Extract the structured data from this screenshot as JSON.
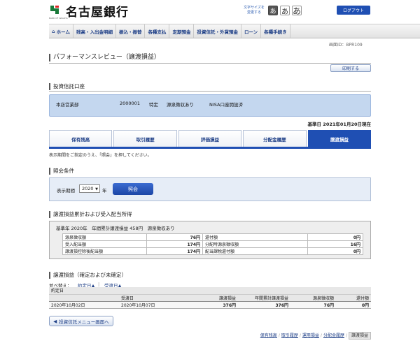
{
  "header": {
    "bank_name": "名古屋銀行",
    "bank_sub": "BANK OF NAGOYA",
    "font_size_label": "文字サイズを変更する",
    "font_sizes": [
      "あ",
      "あ",
      "あ"
    ],
    "logout": "ログアウト"
  },
  "nav": {
    "items": [
      "ホーム",
      "残高・入出金明細",
      "振込・振替",
      "各種支払",
      "定期預金",
      "投資信託・外貨預金",
      "ローン",
      "各種手続き"
    ]
  },
  "page": {
    "screen_id": "画面ID：BPR109",
    "title": "パフォーマンスレビュー（譲渡損益）",
    "print": "印刷する"
  },
  "account": {
    "section_title": "投資信託口座",
    "branch": "本店営業部",
    "number": "2000001",
    "type": "特定",
    "tax": "源泉徴収あり",
    "nisa": "NISA口座開設済"
  },
  "base_date": "基準日 2021年01月20日現在",
  "tabs": [
    "保有残高",
    "取引履歴",
    "評価損益",
    "分配金履歴",
    "譲渡損益"
  ],
  "instruction": "表示期間をご指定のうえ、「照会」を押してください。",
  "condition": {
    "section_title": "照会条件",
    "period_label": "表示期間",
    "year": "2020",
    "year_unit": "年",
    "inquiry": "照会"
  },
  "summary": {
    "section_title": "譲渡損益累計および受入配当所得",
    "head": "基準年 2020年　年間累計譲渡損益 458円　源泉徴収あり",
    "rows": [
      [
        "源泉徴収額",
        "76円",
        "還付額",
        "0円"
      ],
      [
        "受入配当額",
        "174円",
        "分配時源泉徴収額",
        "16円"
      ],
      [
        "譲渡損控除後配当額",
        "174円",
        "配当課税還付額",
        "0円"
      ]
    ]
  },
  "detail": {
    "section_title": "譲渡損益（確定および未確定）",
    "sort_label": "並べ替え：",
    "sort_contract": "約定日▲",
    "sort_delivery": "受渡日▲",
    "headers_top": [
      "約定日",
      "",
      "",
      "",
      "",
      ""
    ],
    "headers": [
      "",
      "受渡日",
      "譲渡損益",
      "年間累計譲渡損益",
      "源泉徴収額",
      "還付額"
    ],
    "rows": [
      [
        "2020年10月02日",
        "2020年10月07日",
        "376円",
        "376円",
        "76円",
        "0円"
      ]
    ]
  },
  "back": "投資信託メニュー画面へ",
  "footer": {
    "links": [
      "保有残高",
      "取引履歴",
      "運用損益",
      "分配金履歴"
    ],
    "current": "譲渡損益",
    "sep": "/"
  }
}
